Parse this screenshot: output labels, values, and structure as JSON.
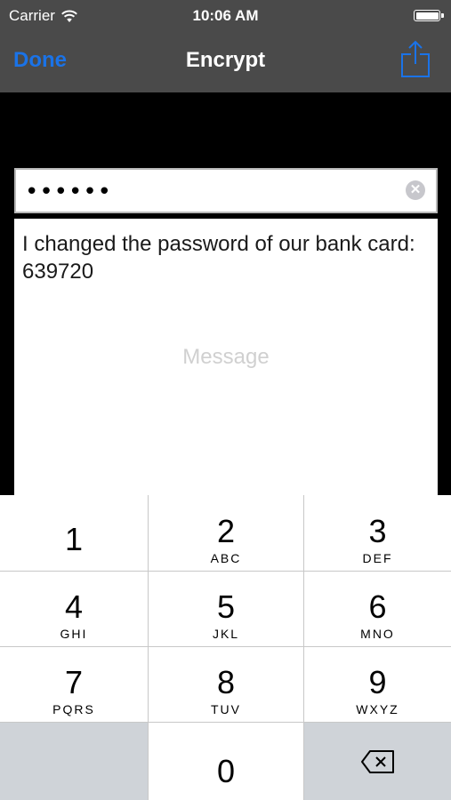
{
  "status_bar": {
    "carrier": "Carrier",
    "time": "10:06 AM"
  },
  "nav": {
    "done_label": "Done",
    "title": "Encrypt",
    "share_icon": "share-icon"
  },
  "password_field": {
    "value": "••••••",
    "clear_icon": "clear-icon"
  },
  "message": {
    "text": "I changed the password of our bank card: 639720",
    "placeholder": "Message"
  },
  "keypad": {
    "keys": [
      {
        "num": "1",
        "letters": ""
      },
      {
        "num": "2",
        "letters": "ABC"
      },
      {
        "num": "3",
        "letters": "DEF"
      },
      {
        "num": "4",
        "letters": "GHI"
      },
      {
        "num": "5",
        "letters": "JKL"
      },
      {
        "num": "6",
        "letters": "MNO"
      },
      {
        "num": "7",
        "letters": "PQRS"
      },
      {
        "num": "8",
        "letters": "TUV"
      },
      {
        "num": "9",
        "letters": "WXYZ"
      },
      {
        "num": "0",
        "letters": ""
      }
    ],
    "delete_icon": "backspace-icon"
  },
  "colors": {
    "bar_bg": "#4a4a4a",
    "accent": "#1a73e8",
    "key_gray": "#cfd3d8"
  }
}
